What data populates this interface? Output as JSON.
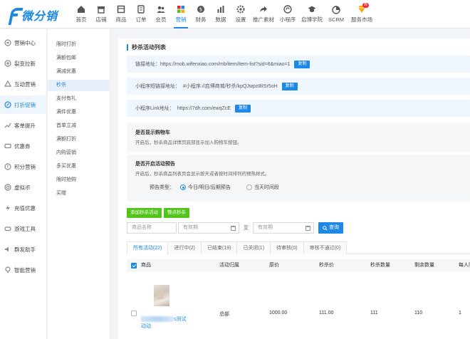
{
  "brand": {
    "name": "微分销",
    "color": "#1e88e5"
  },
  "nav": [
    {
      "label": "首页",
      "icon": "home-icon"
    },
    {
      "label": "店铺",
      "icon": "store-icon"
    },
    {
      "label": "商品",
      "icon": "goods-icon"
    },
    {
      "label": "订单",
      "icon": "order-icon"
    },
    {
      "label": "会员",
      "icon": "member-icon"
    },
    {
      "label": "营销",
      "icon": "marketing-icon",
      "active": true
    },
    {
      "label": "财务",
      "icon": "finance-icon"
    },
    {
      "label": "数据",
      "icon": "data-icon"
    },
    {
      "label": "设置",
      "icon": "settings-icon"
    },
    {
      "label": "推广素材",
      "icon": "share-icon"
    },
    {
      "label": "小程序",
      "icon": "miniapp-icon"
    },
    {
      "label": "启博学院",
      "icon": "academy-icon"
    },
    {
      "label": "SCRM",
      "icon": "scrm-icon"
    },
    {
      "label": "服务市场",
      "icon": "market-icon",
      "badge": "热"
    }
  ],
  "sidebar": [
    {
      "label": "营销中心",
      "icon": "marketing-center-icon"
    },
    {
      "label": "裂变拉新",
      "icon": "fission-icon"
    },
    {
      "label": "互动营销",
      "icon": "interactive-icon"
    },
    {
      "label": "打折促销",
      "icon": "discount-icon",
      "active": true
    },
    {
      "label": "客单提升",
      "icon": "upsell-icon"
    },
    {
      "label": "优惠券",
      "icon": "coupon-icon"
    },
    {
      "label": "积分营销",
      "icon": "points-icon"
    },
    {
      "label": "虚拟币",
      "icon": "coin-icon"
    },
    {
      "label": "充值优惠",
      "icon": "recharge-icon"
    },
    {
      "label": "游戏工具",
      "icon": "game-icon"
    },
    {
      "label": "群发助手",
      "icon": "broadcast-icon"
    },
    {
      "label": "智能营销",
      "icon": "smart-icon"
    }
  ],
  "subnav": [
    {
      "label": "限时打折"
    },
    {
      "label": "满额包邮"
    },
    {
      "label": "满减优惠"
    },
    {
      "label": "秒杀",
      "active": true
    },
    {
      "label": "支付有礼"
    },
    {
      "label": "满件优惠"
    },
    {
      "label": "首单立减"
    },
    {
      "label": "满额打折"
    },
    {
      "label": "内购营销"
    },
    {
      "label": "多买优惠"
    },
    {
      "label": "限时抢购"
    },
    {
      "label": "买赠"
    }
  ],
  "main": {
    "title": "秒杀活动列表",
    "links": [
      {
        "label": "链接地址：",
        "value": "https://mob.wifenxiao.com/mb/item/item-list?sid=6&miao=1",
        "button": "复制"
      },
      {
        "label": "小程序短链接地址：",
        "value": "#小程序://启博商城/秒杀/kpQJwpz8lISr5oH",
        "button": "复制"
      },
      {
        "label": "小程序Link地址：",
        "value": "https://7dh.com/ewqZcE",
        "button": "复制"
      }
    ],
    "cart_option": {
      "title": "是否显示购物车",
      "desc": "开启后，秒杀商品详情页底部显示加入购物车按钮。"
    },
    "preview_option": {
      "title": "是否开启活动预告",
      "desc": "开启后，秒杀商品列表页会显示按天或者按时间排列的预热样式。",
      "type_label": "预告类型：",
      "choices": [
        {
          "label": "今日/明日/后期预告",
          "selected": true
        },
        {
          "label": "当天时间段",
          "selected": false
        }
      ]
    },
    "buttons": {
      "add": "添加秒杀活动",
      "template": "整点秒杀"
    },
    "filter": {
      "name_placeholder": "商品名称",
      "start_placeholder": "有效期",
      "sep": "至",
      "end_placeholder": "有效期",
      "query": "查询"
    },
    "tabs": [
      {
        "label": "所有活动(22)",
        "active": true
      },
      {
        "label": "进行中(2)"
      },
      {
        "label": "已结束(19)"
      },
      {
        "label": "已关闭(1)"
      },
      {
        "label": "待审核(0)"
      },
      {
        "label": "审核不通过(0)"
      }
    ],
    "table": {
      "columns": [
        "商品",
        "活动归属",
        "原价",
        "秒杀价",
        "秒杀数量",
        "剩余数量",
        "每人限购"
      ],
      "rows": [
        {
          "name_suffix": "s测试",
          "name_line2": "动动",
          "owner": "总部",
          "price": "1000.00",
          "seckill_price": "111.00",
          "qty": "111",
          "remain": "110",
          "limit": "1"
        }
      ]
    }
  }
}
